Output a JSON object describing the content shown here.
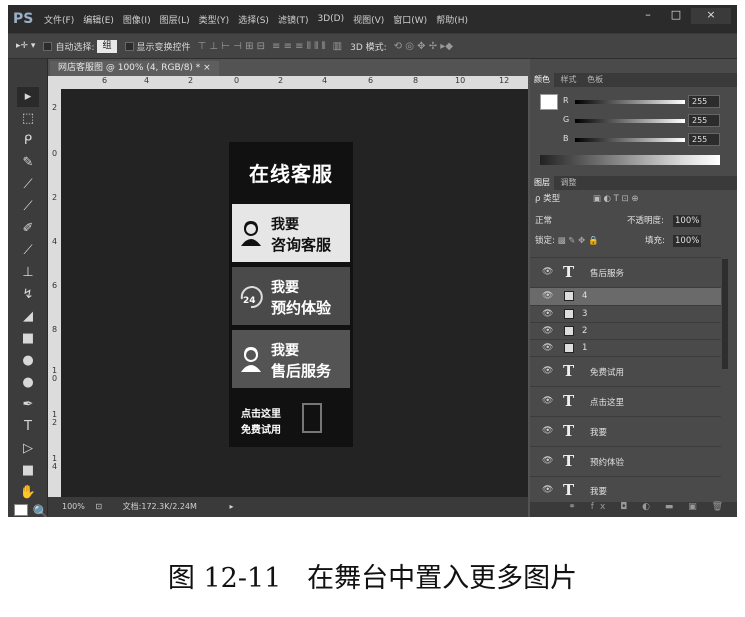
{
  "app": {
    "logo": "PS",
    "menu": [
      "文件(F)",
      "编辑(E)",
      "图像(I)",
      "图层(L)",
      "类型(Y)",
      "选择(S)",
      "滤镜(T)",
      "3D(D)",
      "视图(V)",
      "窗口(W)",
      "帮助(H)"
    ],
    "window_buttons": [
      "–",
      "□",
      "×"
    ]
  },
  "options": {
    "auto_select_label": "自动选择:",
    "auto_select_value": "组",
    "show_transform_label": "显示变换控件",
    "mode_3d_label": "3D 模式:"
  },
  "document": {
    "tab_title": "网店客服图 @ 100% (4, RGB/8) * ×",
    "ruler_top_ticks": [
      "6",
      "4",
      "2",
      "0",
      "2",
      "4",
      "6",
      "8",
      "10",
      "12"
    ],
    "ruler_left_ticks": [
      "2",
      "0",
      "2",
      "4",
      "6",
      "8",
      "1\n0",
      "1\n2",
      "1\n4"
    ],
    "zoom": "100%",
    "doc_info": "文档:172.3K/2.24M"
  },
  "artwork": {
    "title": "在线客服",
    "cards": [
      {
        "line1": "我要",
        "line2": "咨询客服",
        "icon": "service-woman-icon"
      },
      {
        "line1": "我要",
        "line2": "预约体验",
        "icon": "24h-icon"
      },
      {
        "line1": "我要",
        "line2": "售后服务",
        "icon": "service-woman-icon"
      },
      {
        "line1": "点击这里",
        "line2": "免费试用",
        "icon": "document-icon"
      }
    ]
  },
  "color_panel": {
    "tabs": [
      "颜色",
      "样式",
      "色板"
    ],
    "channels": [
      {
        "label": "R",
        "value": "255"
      },
      {
        "label": "G",
        "value": "255"
      },
      {
        "label": "B",
        "value": "255"
      }
    ]
  },
  "layers_panel": {
    "tabs": [
      "图层",
      "调整"
    ],
    "filter_label": "ρ 类型",
    "blend_mode": "正常",
    "opacity_label": "不透明度:",
    "opacity_value": "100%",
    "lock_label": "锁定:",
    "fill_label": "填充:",
    "fill_value": "100%",
    "layers": [
      {
        "type": "text",
        "name": "售后服务",
        "selected": false
      },
      {
        "type": "image",
        "name": "4",
        "selected": true
      },
      {
        "type": "image",
        "name": "3",
        "selected": false
      },
      {
        "type": "image",
        "name": "2",
        "selected": false
      },
      {
        "type": "image",
        "name": "1",
        "selected": false
      },
      {
        "type": "text",
        "name": "免费试用",
        "selected": false
      },
      {
        "type": "text",
        "name": "点击这里",
        "selected": false
      },
      {
        "type": "text",
        "name": "我要",
        "selected": false
      },
      {
        "type": "text",
        "name": "预约体验",
        "selected": false
      },
      {
        "type": "text",
        "name": "我要",
        "selected": false
      }
    ],
    "bottom_icons": "⚭ fx ◘ ◐ ▬ ▣ 🗑"
  },
  "caption": "图 12-11   在舞台中置入更多图片"
}
